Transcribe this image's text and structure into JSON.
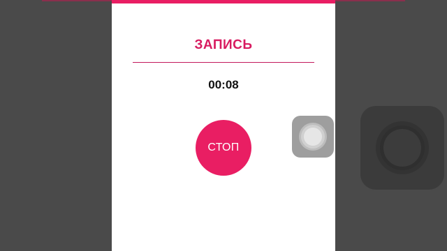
{
  "dialog": {
    "title": "ЗАПИСЬ",
    "timer": "00:08",
    "stop_label": "СТОП"
  },
  "colors": {
    "accent": "#e91e63",
    "title": "#d81b60",
    "backdrop": "#4a4a4a",
    "dialog_background": "#ffffff"
  },
  "icons": {
    "assistive_touch_small": "assistive-touch-icon",
    "assistive_touch_large": "assistive-touch-icon"
  }
}
